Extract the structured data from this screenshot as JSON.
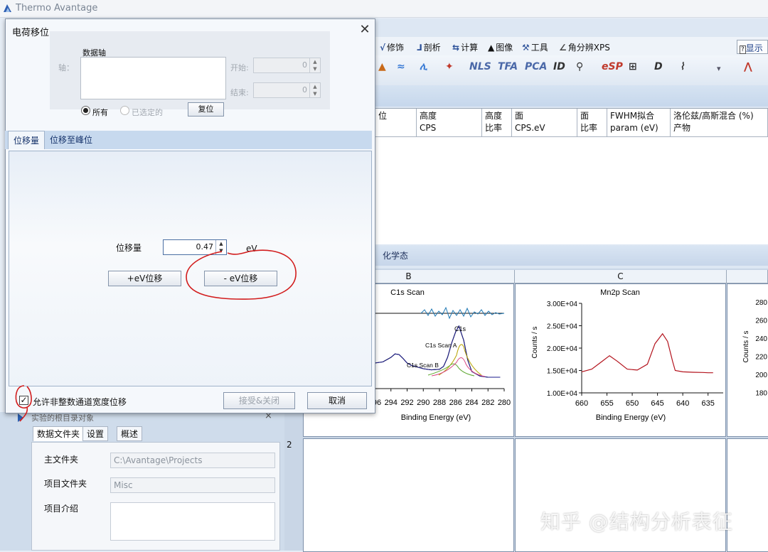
{
  "app": {
    "title": "Thermo Avantage"
  },
  "menu": {
    "items": [
      {
        "label": "修饰",
        "icon": "brush-icon"
      },
      {
        "label": "剖析",
        "icon": "profile-icon"
      },
      {
        "label": "计算",
        "icon": "calculator-icon"
      },
      {
        "label": "图像",
        "icon": "image-icon"
      },
      {
        "label": "工具",
        "icon": "tools-icon"
      },
      {
        "label": "角分辨XPS",
        "icon": "angle-icon"
      }
    ],
    "show_button": "显示"
  },
  "toolbar_icons": [
    "NLS",
    "TFA",
    "PCA",
    "ID",
    "eSP",
    "D"
  ],
  "peak_table": {
    "headers": [
      {
        "l1": "位",
        "l2": ""
      },
      {
        "l1": "高度",
        "l2": "CPS"
      },
      {
        "l1": "高度",
        "l2": "比率"
      },
      {
        "l1": "面",
        "l2": "CPS.eV"
      },
      {
        "l1": "面",
        "l2": "比率"
      },
      {
        "l1": "FWHM拟合",
        "l2": "param (eV)"
      },
      {
        "l1": "洛伦兹/高斯混合 (%)",
        "l2": "产物"
      }
    ]
  },
  "chem_tab": "化学态",
  "grid": {
    "columns": [
      "B",
      "C"
    ],
    "row2": "2"
  },
  "chart_data": [
    {
      "type": "line",
      "title": "C1s Scan",
      "xlabel": "Binding Energy (eV)",
      "x_ticks": [
        "296",
        "294",
        "292",
        "290",
        "288",
        "286",
        "284",
        "282",
        "280"
      ],
      "annotations": [
        "C1s",
        "C1s Scan A",
        "C1s Scan B"
      ],
      "series": [
        {
          "values_x": [
            296,
            295,
            294,
            293.5,
            293,
            292.5,
            292,
            291.5,
            291,
            290,
            289,
            288,
            287.5,
            287,
            286.5,
            286,
            285.6,
            285,
            284.5,
            284,
            283,
            282,
            281,
            280.5
          ],
          "values_y": [
            0.3,
            0.32,
            0.4,
            0.46,
            0.45,
            0.38,
            0.3,
            0.26,
            0.24,
            0.2,
            0.18,
            0.19,
            0.24,
            0.4,
            0.65,
            0.85,
            0.95,
            0.7,
            0.35,
            0.15,
            0.07,
            0.05,
            0.05,
            0.05
          ]
        }
      ]
    },
    {
      "type": "line",
      "title": "Mn2p Scan",
      "xlabel": "Binding Energy (eV)",
      "ylabel": "Counts / s",
      "y_ticks": [
        "1.00E+04",
        "1.50E+04",
        "2.00E+04",
        "2.50E+04",
        "3.00E+04"
      ],
      "x_ticks": [
        "660",
        "655",
        "650",
        "645",
        "640",
        "635"
      ],
      "ylim": [
        10000,
        30000
      ],
      "series": [
        {
          "values_x": [
            660,
            658,
            656,
            654.5,
            653,
            651,
            649,
            647,
            645.5,
            644,
            643,
            642,
            641.5,
            640,
            638,
            636,
            635,
            634
          ],
          "values_y": [
            14700,
            15300,
            17000,
            18300,
            17100,
            15300,
            15100,
            16400,
            21000,
            23200,
            21500,
            17000,
            15000,
            14700,
            14600,
            14550,
            14500,
            14500
          ]
        }
      ]
    }
  ],
  "side_chart": {
    "ylabel": "Counts / s",
    "y_ticks": [
      "280",
      "260",
      "240",
      "220",
      "200",
      "180"
    ]
  },
  "left_panel": {
    "caption": "实验的根目录对象",
    "tabs": [
      "数据文件夹",
      "设置",
      "概述"
    ],
    "main_folder_label": "主文件夹",
    "main_folder_value": "C:\\Avantage\\Projects",
    "project_folder_label": "项目文件夹",
    "project_folder_value": "Misc",
    "project_intro_label": "项目介绍"
  },
  "dialog": {
    "title": "电荷移位",
    "axis_group_label": "数据轴",
    "axis_label": "轴：",
    "start_label": "开始:",
    "start_value": "0",
    "end_label": "结束:",
    "end_value": "0",
    "radio_all": "所有",
    "radio_selected": "已选定的",
    "reset_button": "复位",
    "tabs": [
      "位移量",
      "位移至峰位"
    ],
    "shift_label": "位移量",
    "shift_value": "0.47",
    "shift_unit": "eV",
    "plus_button": "+eV位移",
    "minus_button": "- eV位移",
    "checkbox_label": "允许非整数通道宽度位移",
    "accept_button": "接受&关闭",
    "cancel_button": "取消"
  },
  "watermark": "知乎 @结构分析表征",
  "colors": {
    "accent": "#2a4f98",
    "annotation": "#d21d1d",
    "c1s_line": "#1a1a8c",
    "mn2p_line": "#b3121c"
  }
}
